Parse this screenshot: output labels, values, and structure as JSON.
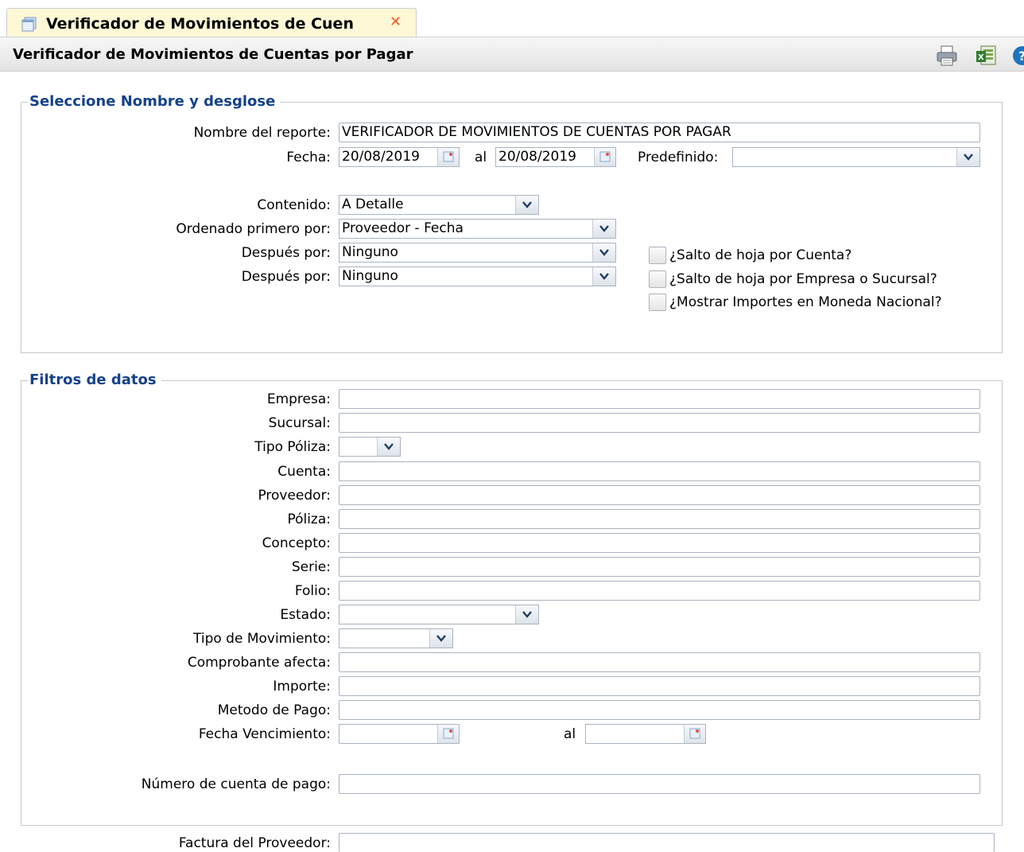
{
  "tab": {
    "title": "Verificador de Movimientos de Cuen",
    "close": "✕"
  },
  "header": {
    "title": "Verificador de Movimientos de Cuentas por Pagar"
  },
  "section1": {
    "legend": "Seleccione Nombre y desglose",
    "nombre_label": "Nombre del reporte:",
    "nombre_value": "VERIFICADOR DE MOVIMIENTOS DE CUENTAS POR PAGAR",
    "fecha_label": "Fecha:",
    "fecha_desde": "20/08/2019",
    "al_label": "al",
    "fecha_hasta": "20/08/2019",
    "predefinido_label": "Predefinido:",
    "predefinido_value": "",
    "contenido_label": "Contenido:",
    "contenido_value": "A Detalle",
    "orden1_label": "Ordenado primero por:",
    "orden1_value": "Proveedor - Fecha",
    "orden2_label": "Después por:",
    "orden2_value": "Ninguno",
    "orden3_label": "Después por:",
    "orden3_value": "Ninguno",
    "check_cuenta": "¿Salto de hoja por Cuenta?",
    "check_empresa": "¿Salto de hoja por Empresa o Sucursal?",
    "check_moneda": "¿Mostrar Importes en Moneda Nacional?"
  },
  "section2": {
    "legend": "Filtros de datos",
    "empresa": "Empresa:",
    "sucursal": "Sucursal:",
    "tipo_poliza": "Tipo Póliza:",
    "cuenta": "Cuenta:",
    "proveedor": "Proveedor:",
    "poliza": "Póliza:",
    "concepto": "Concepto:",
    "serie": "Serie:",
    "folio": "Folio:",
    "estado": "Estado:",
    "tipo_movimiento": "Tipo de Movimiento:",
    "comprobante": "Comprobante afecta:",
    "importe": "Importe:",
    "metodo_pago": "Metodo de Pago:",
    "fecha_venc": "Fecha Vencimiento:",
    "al_label": "al",
    "numero_cuenta": "Número de cuenta de pago:"
  },
  "section3": {
    "factura_label": "Factura del Proveedor:"
  },
  "colors": {
    "legend": "#15428b",
    "tab_bg": "#fff8d6",
    "close": "#e85d2a"
  }
}
